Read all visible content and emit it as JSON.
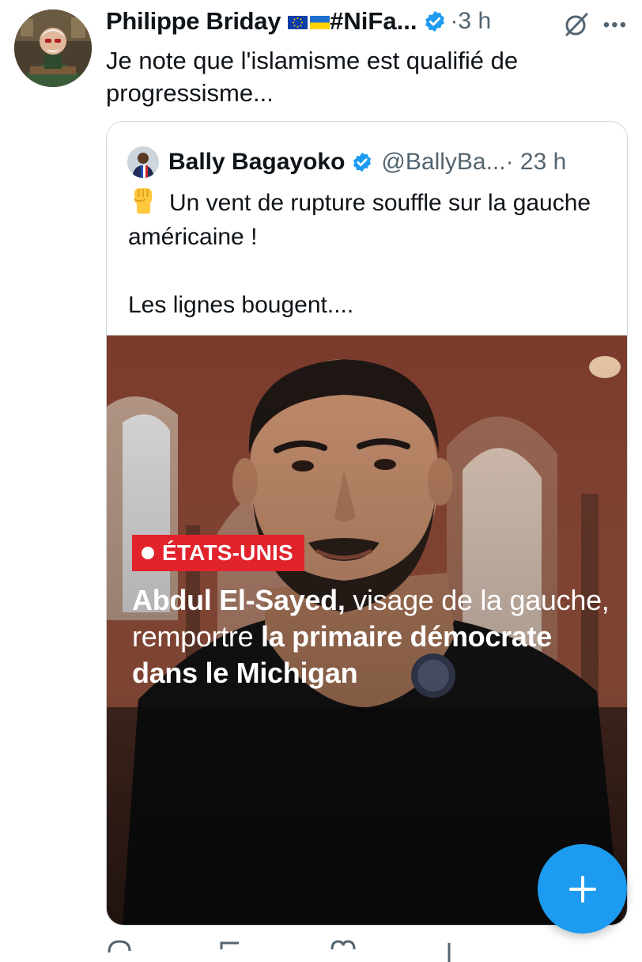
{
  "tweet": {
    "author_name": "Philippe Briday",
    "name_suffix": "#NiFa...",
    "time": "·3 h",
    "text": "Je note que l'islamisme est qualifié de progressisme...",
    "icons": {
      "avatar": "avatar-cartoon",
      "flag_1": "eu-flag",
      "flag_2": "ukraine-flag",
      "verified": "verified-badge",
      "grok": "grok-icon",
      "more": "more-icon"
    }
  },
  "quote": {
    "author_name": "Bally Bagayoko",
    "handle": "@BallyBa...",
    "time": "· 23 h",
    "line_1": "Un vent de rupture souffle sur la gauche américaine !",
    "line_2": "Les lignes bougent....",
    "emoji": "raised-fist-emoji",
    "media": {
      "badge": "ÉTATS-UNIS",
      "headline_part_1": "Abdul El-Sayed,",
      "headline_part_2": " visage de la gauche, remportre ",
      "headline_part_3": "la primaire démocrate dans le Michigan"
    }
  },
  "fab": {
    "label": "+",
    "icon": "plus-icon"
  },
  "colors": {
    "accent": "#1d9bf0",
    "badge_red": "#e1232c",
    "text": "#0f1419",
    "secondary_text": "#536471",
    "border": "#cfd9de"
  }
}
